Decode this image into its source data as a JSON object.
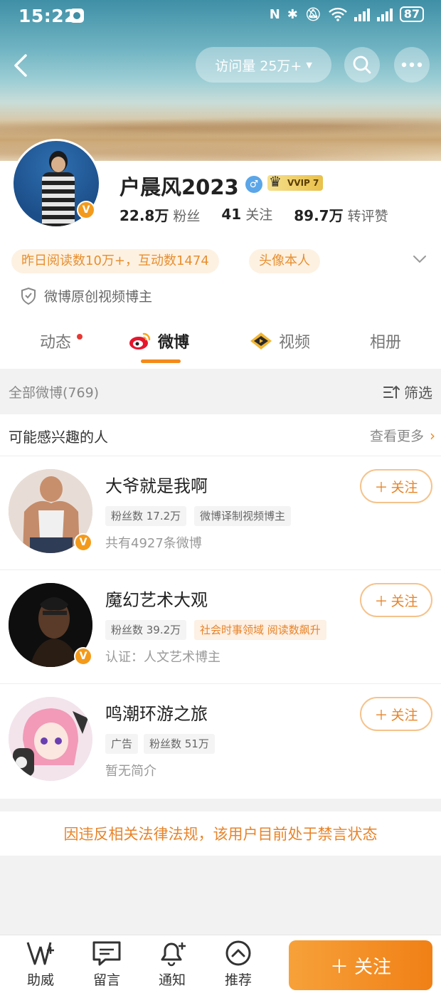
{
  "status_bar": {
    "time": "15:22",
    "battery": "87"
  },
  "header": {
    "visits_label": "访问量 25万+"
  },
  "profile": {
    "username": "户晨风2023",
    "vip_label": "VVIP",
    "vip_level": "7",
    "stats": [
      {
        "value": "22.8万",
        "label": "粉丝"
      },
      {
        "value": "41",
        "label": "关注"
      },
      {
        "value": "89.7万",
        "label": "转评赞"
      }
    ],
    "tags": [
      "昨日阅读数10万+，互动数1474",
      "头像本人"
    ],
    "creator_label": "微博原创视频博主"
  },
  "tabs": [
    {
      "label": "动态",
      "icon": "none",
      "active": false
    },
    {
      "label": "微博",
      "icon": "weibo-icon",
      "active": true
    },
    {
      "label": "视频",
      "icon": "video-icon",
      "active": false
    },
    {
      "label": "相册",
      "icon": "none",
      "active": false
    }
  ],
  "filter": {
    "all_label": "全部微博(769)",
    "filter_label": "筛选"
  },
  "suggestions": {
    "title": "可能感兴趣的人",
    "see_more": "查看更多",
    "follow_label": "关注",
    "items": [
      {
        "name": "大爷就是我啊",
        "chips": [
          "粉丝数 17.2万",
          "微博译制视频博主"
        ],
        "desc": "共有4927条微博"
      },
      {
        "name": "魔幻艺术大观",
        "chips": [
          "粉丝数 39.2万",
          "社会时事领域 阅读数飙升"
        ],
        "desc": "认证：人文艺术博主"
      },
      {
        "name": "鸣潮环游之旅",
        "chips": [
          "广告",
          "粉丝数 51万"
        ],
        "desc": "暂无简介"
      }
    ]
  },
  "ban_notice": "因违反相关法律法规，该用户目前处于禁言状态",
  "bottom_bar": {
    "items": [
      "助威",
      "留言",
      "通知",
      "推荐"
    ],
    "follow_label": "关注"
  },
  "colors": {
    "accent": "#f38a1a",
    "tag_bg": "#fdf1e2"
  }
}
